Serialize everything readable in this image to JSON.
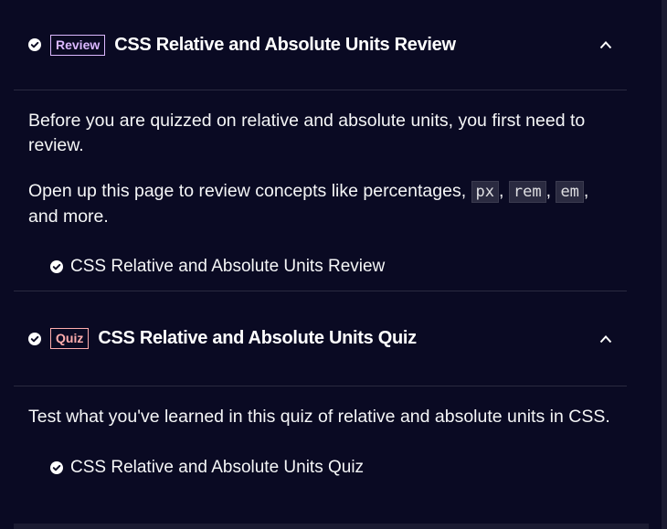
{
  "sections": [
    {
      "badge": "Review",
      "title": "CSS Relative and Absolute Units Review",
      "paragraph1": "Before you are quizzed on relative and absolute units, you first need to review.",
      "paragraph2_prefix": "Open up this page to review concepts like percentages,",
      "codes": [
        "px",
        "rem",
        "em"
      ],
      "paragraph2_suffix": "and more.",
      "link": "CSS Relative and Absolute Units Review"
    },
    {
      "badge": "Quiz",
      "title": "CSS Relative and Absolute Units Quiz",
      "paragraph1": "Test what you've learned in this quiz of relative and absolute units in CSS.",
      "link": "CSS Relative and Absolute Units Quiz"
    }
  ],
  "colors": {
    "background": "#0a0a23",
    "review_badge": "#dbb8ff",
    "quiz_badge": "#ffadad",
    "text": "#ffffff"
  },
  "icons": {
    "completed": "check-circle-icon",
    "collapse": "chevron-up-icon"
  }
}
